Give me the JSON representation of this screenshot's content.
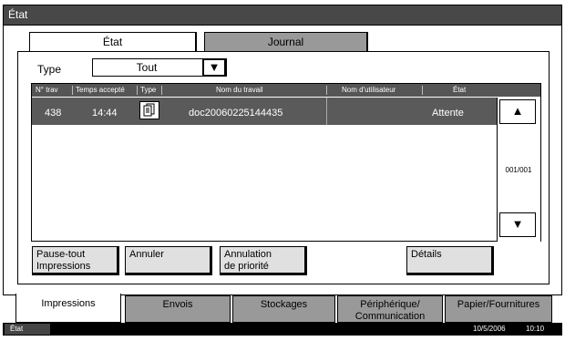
{
  "window": {
    "title": "État"
  },
  "top_tabs": [
    {
      "label": "État",
      "active": true
    },
    {
      "label": "Journal",
      "active": false
    }
  ],
  "filter": {
    "label": "Type",
    "selected": "Tout",
    "arrow": "▼"
  },
  "table": {
    "headers": [
      "N° trav",
      "Temps accepté",
      "Type",
      "Nom du travail",
      "Nom d'utilisateur",
      "État"
    ],
    "rows": [
      {
        "job_no": "438",
        "time": "14:44",
        "type_icon": "document-icon",
        "name": "doc20060225144435",
        "user": "",
        "status": "Attente"
      }
    ]
  },
  "scroll": {
    "up": "▲",
    "down": "▼",
    "page": "001/001"
  },
  "actions": {
    "pause": "Pause-tout\nImpressions",
    "cancel": "Annuler",
    "priority": "Annulation\nde priorité",
    "details": "Détails"
  },
  "bottom_tabs": [
    {
      "label": "Impressions",
      "active": true
    },
    {
      "label": "Envois",
      "active": false
    },
    {
      "label": "Stockages",
      "active": false
    },
    {
      "label": "Périphérique/\nCommunication",
      "active": false
    },
    {
      "label": "Papier/Fournitures",
      "active": false
    }
  ],
  "status_bar": {
    "left": "État",
    "date": "10/5/2006",
    "time": "10:10"
  },
  "colors": {
    "title_bar": "#484848",
    "inactive_tab": "#999999",
    "selected_row": "#5a5a5a"
  }
}
